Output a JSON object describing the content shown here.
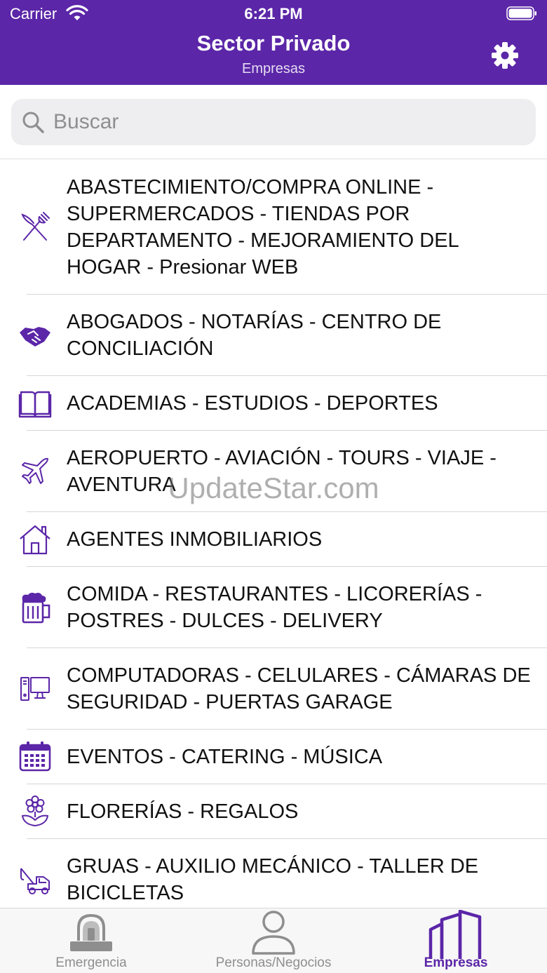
{
  "status_bar": {
    "carrier": "Carrier",
    "time": "6:21 PM"
  },
  "header": {
    "title": "Sector Privado",
    "subtitle": "Empresas"
  },
  "search": {
    "placeholder": "Buscar",
    "value": ""
  },
  "watermark": "UpdateStar.com",
  "items": [
    {
      "label": "ABASTECIMIENTO/COMPRA ONLINE - SUPERMERCADOS - TIENDAS POR DEPARTAMENTO - MEJORAMIENTO DEL HOGAR - Presionar WEB",
      "icon": "fork-knife-icon"
    },
    {
      "label": "ABOGADOS - NOTARÍAS - CENTRO DE CONCILIACIÓN",
      "icon": "handshake-icon"
    },
    {
      "label": "ACADEMIAS - ESTUDIOS - DEPORTES",
      "icon": "book-icon"
    },
    {
      "label": "AEROPUERTO - AVIACIÓN - TOURS - VIAJE - AVENTURA",
      "icon": "airplane-icon"
    },
    {
      "label": "AGENTES INMOBILIARIOS",
      "icon": "house-icon"
    },
    {
      "label": "COMIDA - RESTAURANTES - LICORERÍAS - POSTRES - DULCES - DELIVERY",
      "icon": "beer-mug-icon"
    },
    {
      "label": "COMPUTADORAS - CELULARES - CÁMARAS DE SEGURIDAD - PUERTAS GARAGE",
      "icon": "computer-icon"
    },
    {
      "label": "EVENTOS - CATERING - MÚSICA",
      "icon": "calendar-icon"
    },
    {
      "label": "FLORERÍAS - REGALOS",
      "icon": "flower-icon"
    },
    {
      "label": "GRUAS - AUXILIO MECÁNICO - TALLER DE BICICLETAS",
      "icon": "tow-truck-icon"
    }
  ],
  "tabs": [
    {
      "label": "Emergencia",
      "icon": "siren-icon",
      "active": false
    },
    {
      "label": "Personas/Negocios",
      "icon": "person-icon",
      "active": false
    },
    {
      "label": "Empresas",
      "icon": "buildings-icon",
      "active": true
    }
  ],
  "colors": {
    "accent": "#5b26a8",
    "inactive": "#8e8e8e"
  }
}
